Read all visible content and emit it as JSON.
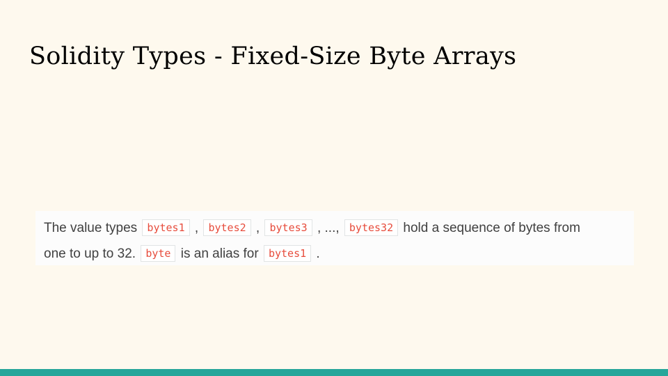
{
  "slide": {
    "title": "Solidity Types - Fixed-Size Byte Arrays"
  },
  "snippet": {
    "line1": {
      "t1": "The value types ",
      "c1": "bytes1",
      "t2": " , ",
      "c2": "bytes2",
      "t3": " , ",
      "c3": "bytes3",
      "t4": " , ..., ",
      "c4": "bytes32",
      "t5": " hold a sequence of bytes from"
    },
    "line2": {
      "t1": "one to up to 32. ",
      "c1": "byte",
      "t2": " is an alias for ",
      "c2": "bytes1",
      "t3": " ."
    }
  },
  "colors": {
    "background": "#fef9ee",
    "accent_bar": "#26a69a",
    "code_text": "#e74c3c",
    "body_text": "#404040"
  }
}
